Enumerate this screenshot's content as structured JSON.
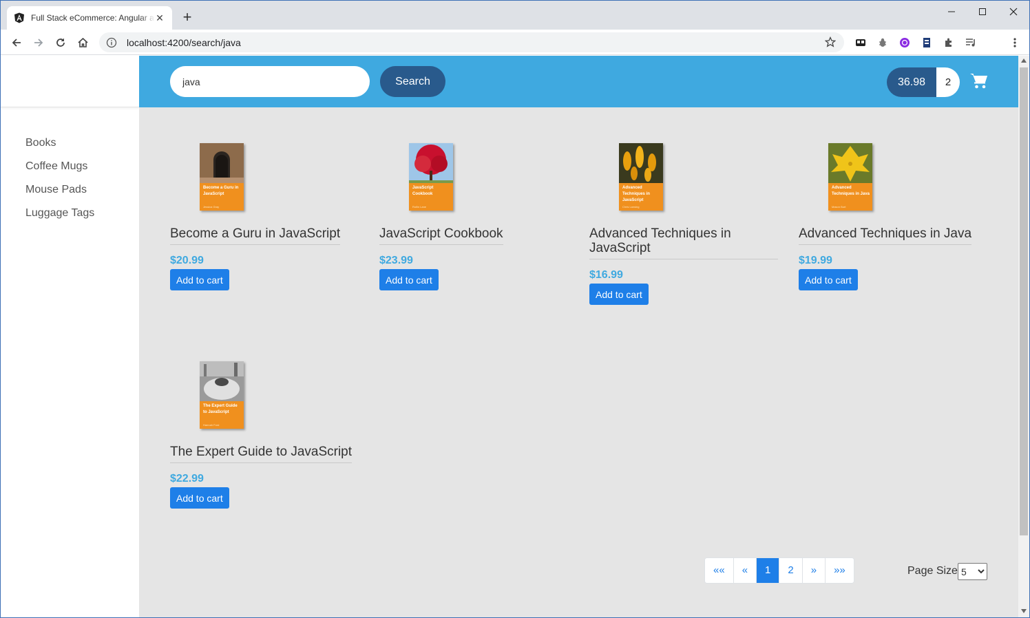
{
  "browser": {
    "tab_title": "Full Stack eCommerce: Angular and Spring Boot",
    "url": "localhost:4200/search/java",
    "new_tab_icon": "plus-icon",
    "colors": {
      "frame": "#dee1e6",
      "accent_border": "#3c6fb5"
    }
  },
  "header": {
    "search_value": "java",
    "search_label": "Search",
    "cart_total": "36.98",
    "cart_quantity": "2",
    "colors": {
      "bar": "#3fa9e0",
      "button": "#295a8c"
    }
  },
  "sidebar": {
    "items": [
      {
        "label": "Books"
      },
      {
        "label": "Coffee Mugs"
      },
      {
        "label": "Mouse Pads"
      },
      {
        "label": "Luggage Tags"
      }
    ]
  },
  "products": [
    {
      "name": "Become a Guru in JavaScript",
      "price": "$20.99",
      "cover_text": "Become a Guru in JavaScript",
      "cover_author": "Jessica Gray",
      "button": "Add to cart"
    },
    {
      "name": "JavaScript Cookbook",
      "price": "$23.99",
      "cover_text": "JavaScript Cookbook",
      "cover_author": "Rollin Lane",
      "button": "Add to cart"
    },
    {
      "name": "Advanced Techniques in JavaScript",
      "price": "$16.99",
      "cover_text": "Advanced Techniques in JavaScript",
      "cover_author": "Chris Lansing",
      "button": "Add to cart"
    },
    {
      "name": "Advanced Techniques in Java",
      "price": "$19.99",
      "cover_text": "Advanced Techniques in Java",
      "cover_author": "Mason Burt",
      "button": "Add to cart"
    },
    {
      "name": "The Expert Guide to JavaScript",
      "price": "$22.99",
      "cover_text": "The Expert Guide to JavaScript",
      "cover_author": "Hannah Ford",
      "button": "Add to cart"
    }
  ],
  "pagination": {
    "first": "««",
    "prev": "«",
    "pages": [
      "1",
      "2"
    ],
    "current": "1",
    "next": "»",
    "last": "»»",
    "page_size_label": "Page Size",
    "page_size_value": "5"
  }
}
